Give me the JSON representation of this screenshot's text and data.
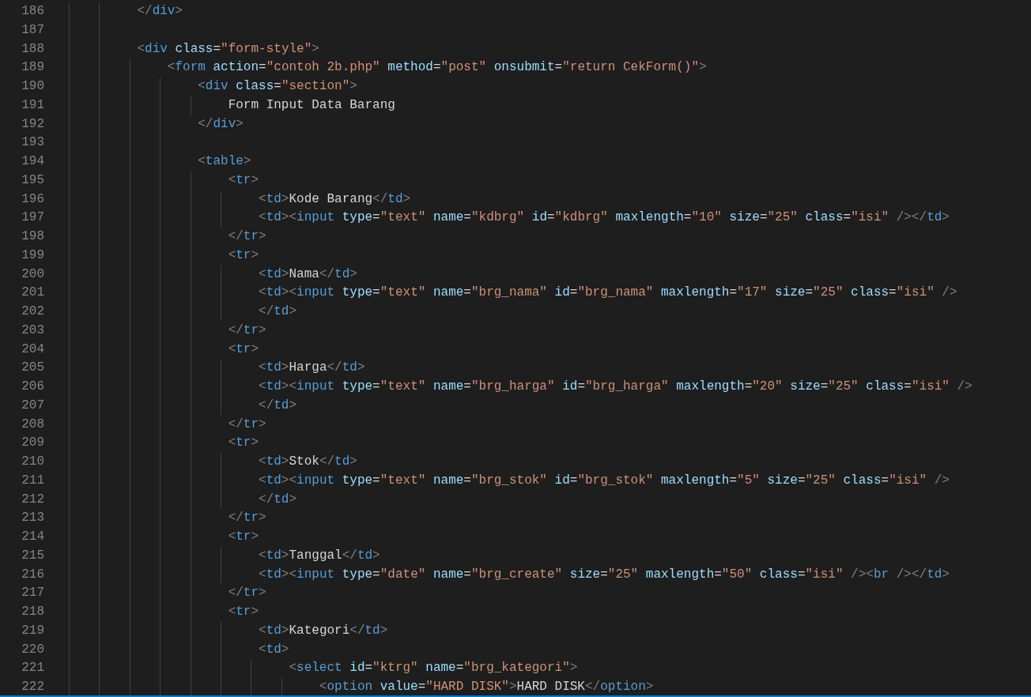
{
  "editor": {
    "lines": [
      {
        "number": "186",
        "code": "        </div>"
      },
      {
        "number": "187"
      },
      {
        "number": "188",
        "code": "        <div class=\"form-style\">"
      },
      {
        "number": "189",
        "code": "            <form action=\"contoh 2b.php\" method=\"post\" onsubmit=\"return CekForm()\">"
      },
      {
        "number": "190",
        "code": "                <div class=\"section\">"
      },
      {
        "number": "191",
        "code": "                    Form Input Data Barang"
      },
      {
        "number": "192",
        "code": "                </div>"
      },
      {
        "number": "193"
      },
      {
        "number": "194",
        "code": "                <table>"
      },
      {
        "number": "195",
        "code": "                    <tr>"
      },
      {
        "number": "196",
        "code": "                        <td>Kode Barang</td>"
      },
      {
        "number": "197",
        "code": "                        <td><input type=\"text\" name=\"kdbrg\" id=\"kdbrg\" maxlength=\"10\" size=\"25\" class=\"isi\" /></td>"
      },
      {
        "number": "198",
        "code": "                    </tr>"
      },
      {
        "number": "199",
        "code": "                    <tr>"
      },
      {
        "number": "200",
        "code": "                        <td>Nama</td>"
      },
      {
        "number": "201",
        "code": "                        <td><input type=\"text\" name=\"brg_nama\" id=\"brg_nama\" maxlength=\"17\" size=\"25\" class=\"isi\" />"
      },
      {
        "number": "202",
        "code": "                        </td>"
      },
      {
        "number": "203",
        "code": "                    </tr>"
      },
      {
        "number": "204",
        "code": "                    <tr>"
      },
      {
        "number": "205",
        "code": "                        <td>Harga</td>"
      },
      {
        "number": "206",
        "code": "                        <td><input type=\"text\" name=\"brg_harga\" id=\"brg_harga\" maxlength=\"20\" size=\"25\" class=\"isi\" />"
      },
      {
        "number": "207",
        "code": "                        </td>"
      },
      {
        "number": "208",
        "code": "                    </tr>"
      },
      {
        "number": "209",
        "code": "                    <tr>"
      },
      {
        "number": "210",
        "code": "                        <td>Stok</td>"
      },
      {
        "number": "211",
        "code": "                        <td><input type=\"text\" name=\"brg_stok\" id=\"brg_stok\" maxlength=\"5\" size=\"25\" class=\"isi\" />"
      },
      {
        "number": "212",
        "code": "                        </td>"
      },
      {
        "number": "213",
        "code": "                    </tr>"
      },
      {
        "number": "214",
        "code": "                    <tr>"
      },
      {
        "number": "215",
        "code": "                        <td>Tanggal</td>"
      },
      {
        "number": "216",
        "code": "                        <td><input type=\"date\" name=\"brg_create\" size=\"25\" maxlength=\"50\" class=\"isi\" /><br /></td>"
      },
      {
        "number": "217",
        "code": "                    </tr>"
      },
      {
        "number": "218",
        "code": "                    <tr>"
      },
      {
        "number": "219",
        "code": "                        <td>Kategori</td>"
      },
      {
        "number": "220",
        "code": "                        <td>"
      },
      {
        "number": "221",
        "code": "                            <select id=\"ktrg\" name=\"brg_kategori\">"
      },
      {
        "number": "222",
        "code": "                                <option value=\"HARD DISK\">HARD DISK</option>"
      }
    ]
  }
}
